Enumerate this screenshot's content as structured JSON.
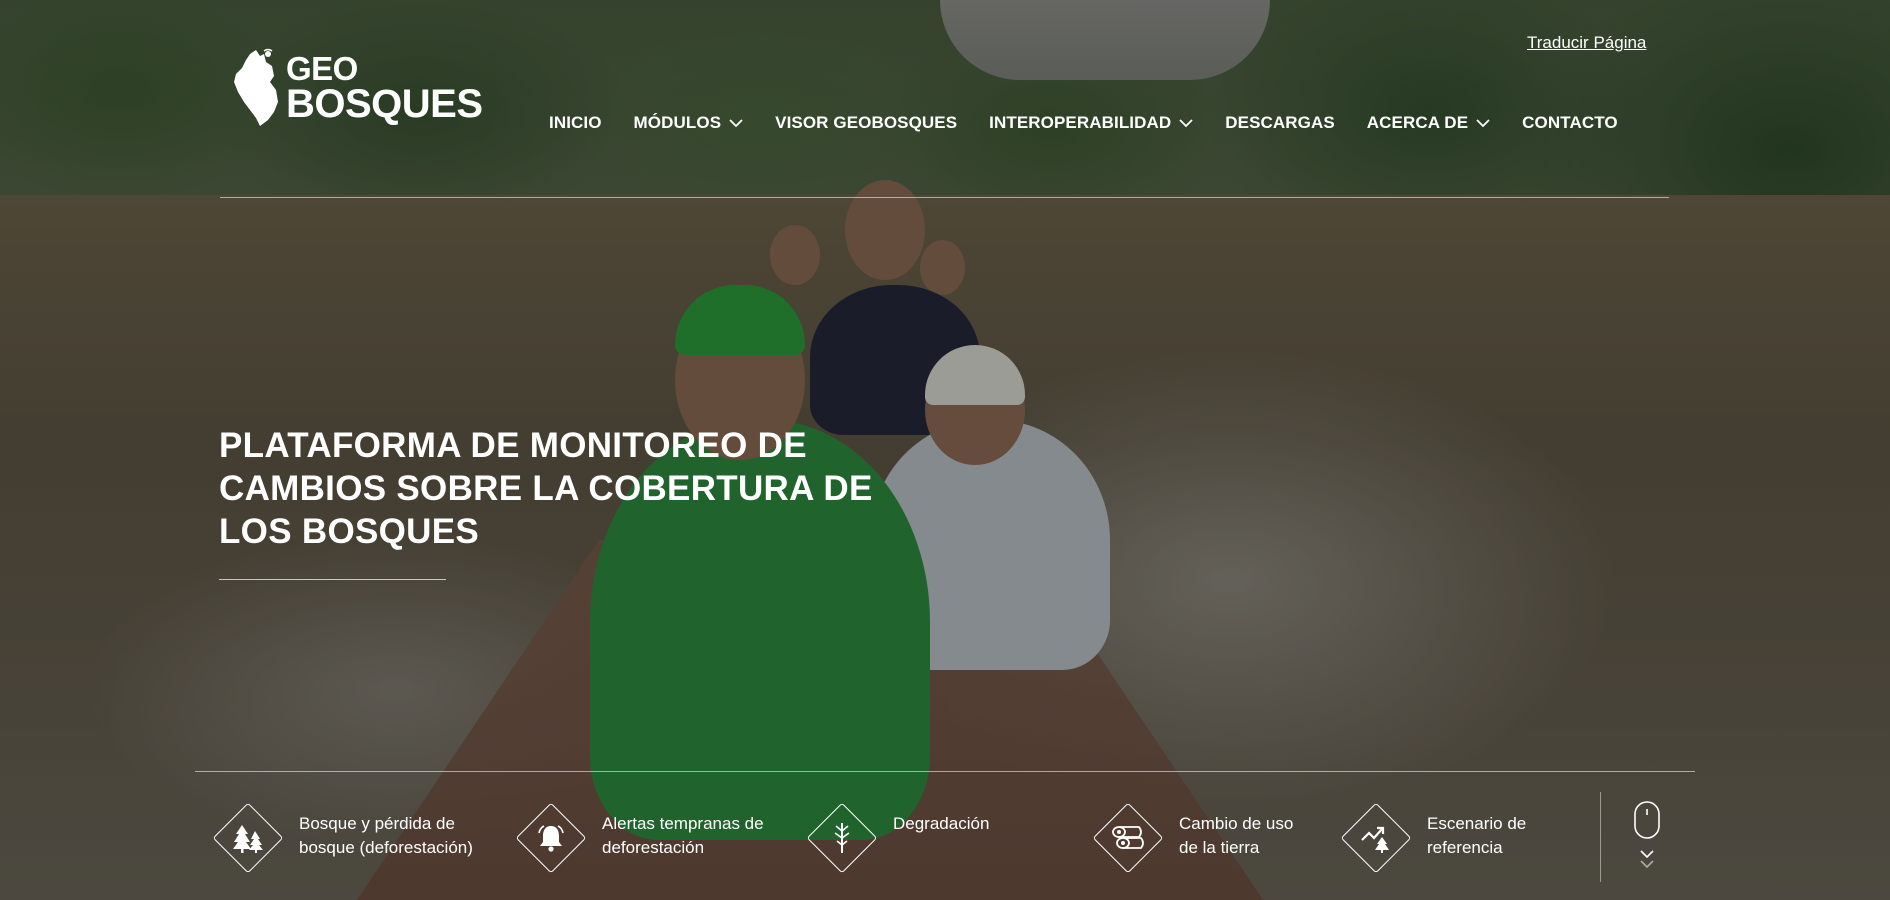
{
  "header": {
    "translate_link": "Traducir Página",
    "logo": {
      "line1": "GEO",
      "line2": "BOSQUES"
    },
    "nav": [
      {
        "label": "INICIO",
        "has_dropdown": false
      },
      {
        "label": "MÓDULOS",
        "has_dropdown": true
      },
      {
        "label": "VISOR GEOBOSQUES",
        "has_dropdown": false
      },
      {
        "label": "INTEROPERABILIDAD",
        "has_dropdown": true
      },
      {
        "label": "DESCARGAS",
        "has_dropdown": false
      },
      {
        "label": "ACERCA DE",
        "has_dropdown": true
      },
      {
        "label": "CONTACTO",
        "has_dropdown": false
      }
    ]
  },
  "hero": {
    "title": "PLATAFORMA DE MONITOREO DE CAMBIOS SOBRE LA COBERTURA DE LOS BOSQUES"
  },
  "modules": [
    {
      "label_line1": "Bosque y pérdida de",
      "label_line2": "bosque (deforestación)",
      "icon": "forest-trees-icon"
    },
    {
      "label_line1": "Alertas tempranas de",
      "label_line2": "deforestación",
      "icon": "bell-alert-icon"
    },
    {
      "label_line1": "Degradación",
      "label_line2": "",
      "icon": "degraded-tree-icon"
    },
    {
      "label_line1": "Cambio de uso",
      "label_line2": "de la tierra",
      "icon": "logs-land-use-icon"
    },
    {
      "label_line1": "Escenario de",
      "label_line2": "referencia",
      "icon": "trend-scenario-icon"
    }
  ],
  "scroll_indicator": {
    "icon": "mouse-scroll-icon"
  },
  "colors": {
    "text": "#ffffff",
    "divider": "rgba(255,255,255,0.55)"
  }
}
